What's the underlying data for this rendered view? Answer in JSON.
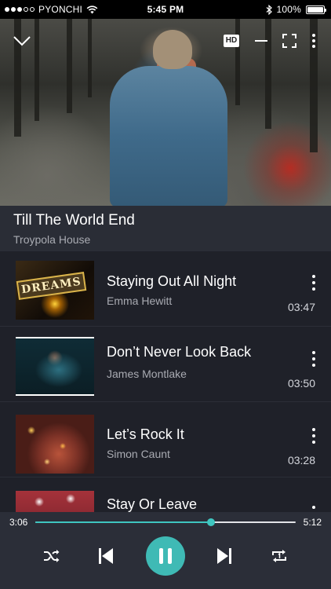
{
  "status_bar": {
    "carrier": "PYONCHI",
    "time": "5:45 PM",
    "battery": "100%",
    "signal_level": 3,
    "signal_max": 5,
    "battery_level": 1.0
  },
  "video": {
    "hd_badge": "HD",
    "icons": [
      "chevron-down-icon",
      "hd-icon",
      "minimize-icon",
      "fullscreen-icon",
      "more-vertical-icon"
    ]
  },
  "now_playing": {
    "title": "Till The World End",
    "artist": "Troypola House"
  },
  "playlist": [
    {
      "title": "Staying Out All Night",
      "artist": "Emma Hewitt",
      "duration": "03:47",
      "thumb_text": "DREAMS"
    },
    {
      "title": "Don’t Never Look Back",
      "artist": "James Montlake",
      "duration": "03:50"
    },
    {
      "title": "Let’s Rock It",
      "artist": "Simon Caunt",
      "duration": "03:28"
    },
    {
      "title": "Stay Or Leave",
      "artist": "",
      "duration": ""
    }
  ],
  "player": {
    "current_time": "3:06",
    "total_time": "5:12",
    "progress": 0.675,
    "state": "playing",
    "accent_color": "#3fbab5",
    "icons": [
      "shuffle-icon",
      "previous-icon",
      "pause-icon",
      "next-icon",
      "repeat-one-icon"
    ]
  }
}
